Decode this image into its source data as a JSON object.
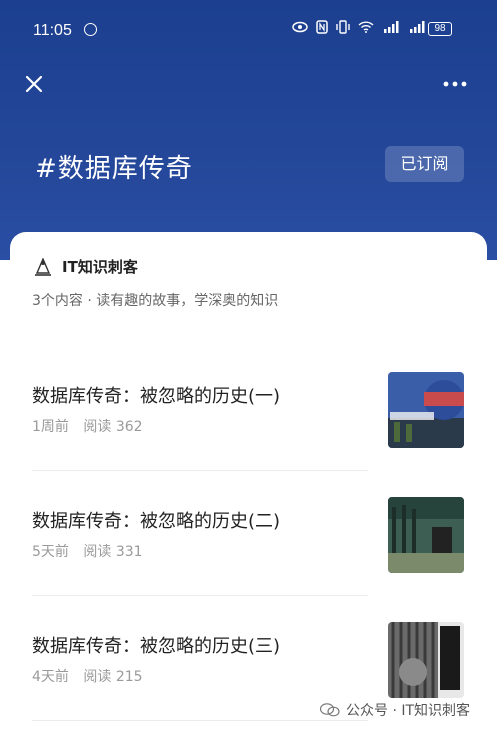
{
  "status_bar": {
    "time": "11:05",
    "battery": "98"
  },
  "topic": {
    "title": "#数据库传奇",
    "subscribe_label": "已订阅"
  },
  "author": {
    "name": "IT知识刺客",
    "description": "3个内容 · 读有趣的故事，学深奥的知识"
  },
  "articles": [
    {
      "title": "数据库传奇：被忽略的历史(一)",
      "time": "1周前",
      "reads": "阅读 362"
    },
    {
      "title": "数据库传奇：被忽略的历史(二)",
      "time": "5天前",
      "reads": "阅读 331"
    },
    {
      "title": "数据库传奇：被忽略的历史(三)",
      "time": "4天前",
      "reads": "阅读 215"
    }
  ],
  "watermark": {
    "text": "公众号 · IT知识刺客"
  },
  "colors": {
    "header": "#24479a",
    "accent_white": "#ffffff"
  }
}
